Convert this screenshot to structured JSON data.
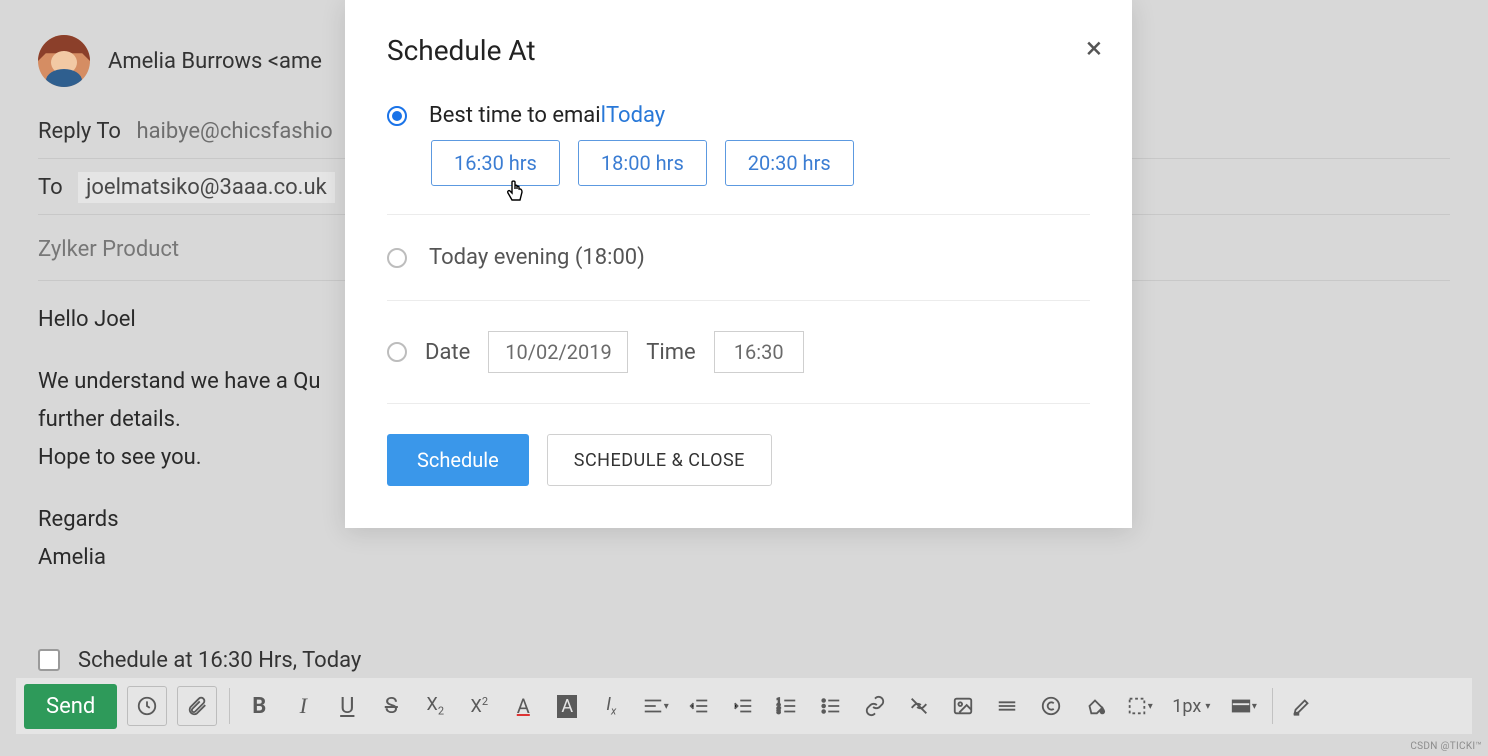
{
  "compose": {
    "from": "Amelia Burrows <ame",
    "reply_label": "Reply To",
    "reply_value": "haibye@chicsfashio",
    "to_label": "To",
    "to_value": "joelmatsiko@3aaa.co.uk",
    "subject": "Zylker Product",
    "body": {
      "greeting": "Hello Joel",
      "line1": "We understand we have a Qu",
      "line2": "further details.",
      "line3": "Hope to see you.",
      "regards": "Regards",
      "signature": "Amelia"
    },
    "schedule_checkbox_label": "Schedule at 16:30 Hrs, Today"
  },
  "toolbar": {
    "send": "Send",
    "thickness_label": "1px"
  },
  "modal": {
    "title": "Schedule At",
    "best_time_prefix": "Best time to emai",
    "best_time_link": "lToday",
    "times": [
      "16:30 hrs",
      "18:00 hrs",
      "20:30 hrs"
    ],
    "evening_label": "Today evening (18:00)",
    "date_label": "Date",
    "date_value": "10/02/2019",
    "time_label": "Time",
    "time_value": "16:30",
    "schedule_btn": "Schedule",
    "schedule_close_btn": "SCHEDULE & CLOSE"
  },
  "watermark": "CSDN @TICKI™"
}
